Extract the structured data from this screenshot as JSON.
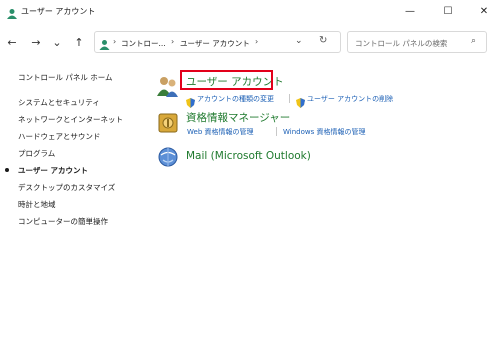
{
  "window": {
    "title": "ユーザー アカウント",
    "minimize_glyph": "—",
    "maximize_glyph": "☐",
    "close_glyph": "✕"
  },
  "nav": {
    "back_glyph": "←",
    "forward_glyph": "→",
    "recent_glyph": "⌄",
    "up_glyph": "↑"
  },
  "address": {
    "separator": "›",
    "crumbs": [
      "コントロー...",
      "ユーザー アカウント"
    ],
    "dropdown_glyph": "⌄",
    "refresh_glyph": "↻"
  },
  "search": {
    "placeholder": "コントロール パネルの検索",
    "icon_glyph": "⌕"
  },
  "sidebar": {
    "home": "コントロール パネル ホーム",
    "items": [
      "システムとセキュリティ",
      "ネットワークとインターネット",
      "ハードウェアとサウンド",
      "プログラム",
      "ユーザー アカウント",
      "デスクトップのカスタマイズ",
      "時計と地域",
      "コンピューターの簡単操作"
    ],
    "selected_index": 4
  },
  "main": {
    "categories": [
      {
        "title": "ユーザー アカウント",
        "links": [
          "アカウントの種類の変更",
          "ユーザー アカウントの削除"
        ]
      },
      {
        "title": "資格情報マネージャー",
        "links": [
          "Web 資格情報の管理",
          "Windows 資格情報の管理"
        ]
      },
      {
        "title": "Mail (Microsoft Outlook)",
        "links": []
      }
    ]
  },
  "colors": {
    "link_green": "#1f7a2e",
    "link_blue": "#1b5fb5",
    "highlight_red": "#e2001a"
  },
  "icons": [
    "users-icon",
    "shield-icon",
    "credential-vault-icon",
    "mail-icon",
    "control-panel-icon"
  ]
}
